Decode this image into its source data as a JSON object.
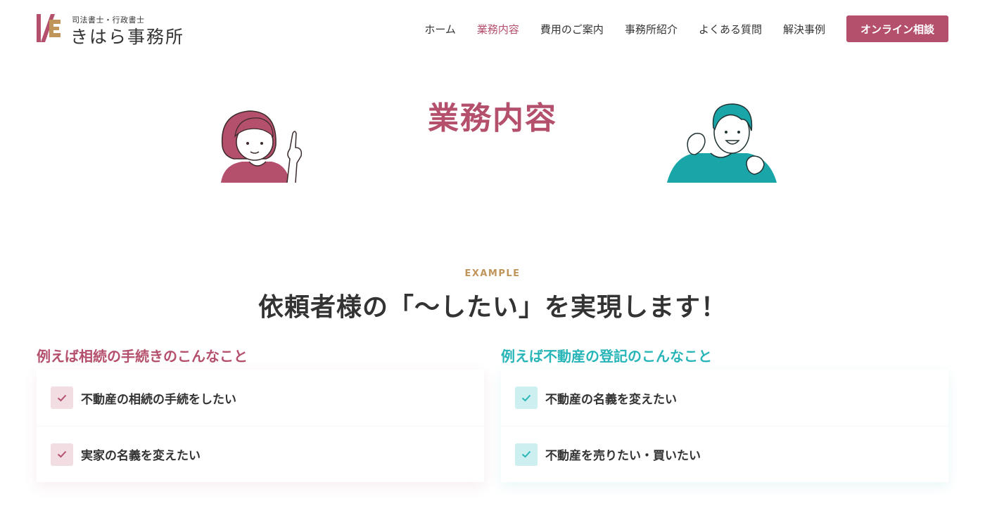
{
  "header": {
    "logo_sub": "司法書士・行政書士",
    "logo_main": "きはら事務所",
    "nav": [
      {
        "label": "ホーム",
        "active": false
      },
      {
        "label": "業務内容",
        "active": true
      },
      {
        "label": "費用のご案内",
        "active": false
      },
      {
        "label": "事務所紹介",
        "active": false
      },
      {
        "label": "よくある質問",
        "active": false
      },
      {
        "label": "解決事例",
        "active": false
      }
    ],
    "cta_label": "オンライン相談"
  },
  "hero": {
    "title": "業務内容",
    "illustrations": [
      "woman-pointing-illustration",
      "man-cheering-illustration"
    ]
  },
  "example": {
    "eyebrow": "EXAMPLE",
    "title": "依頼者様の「〜したい」を実現します！",
    "left": {
      "heading": "例えば相続の手続きのこんなこと",
      "items": [
        "不動産の相続の手続をしたい",
        "実家の名義を変えたい"
      ]
    },
    "right": {
      "heading": "例えば不動産の登記のこんなこと",
      "items": [
        "不動産の名義を変えたい",
        "不動産を売りたい・買いたい"
      ]
    }
  },
  "colors": {
    "accent": "#b44f6c",
    "teal": "#27b5b8",
    "gold": "#c0955a",
    "text": "#333333"
  },
  "icons": [
    "check-icon"
  ]
}
